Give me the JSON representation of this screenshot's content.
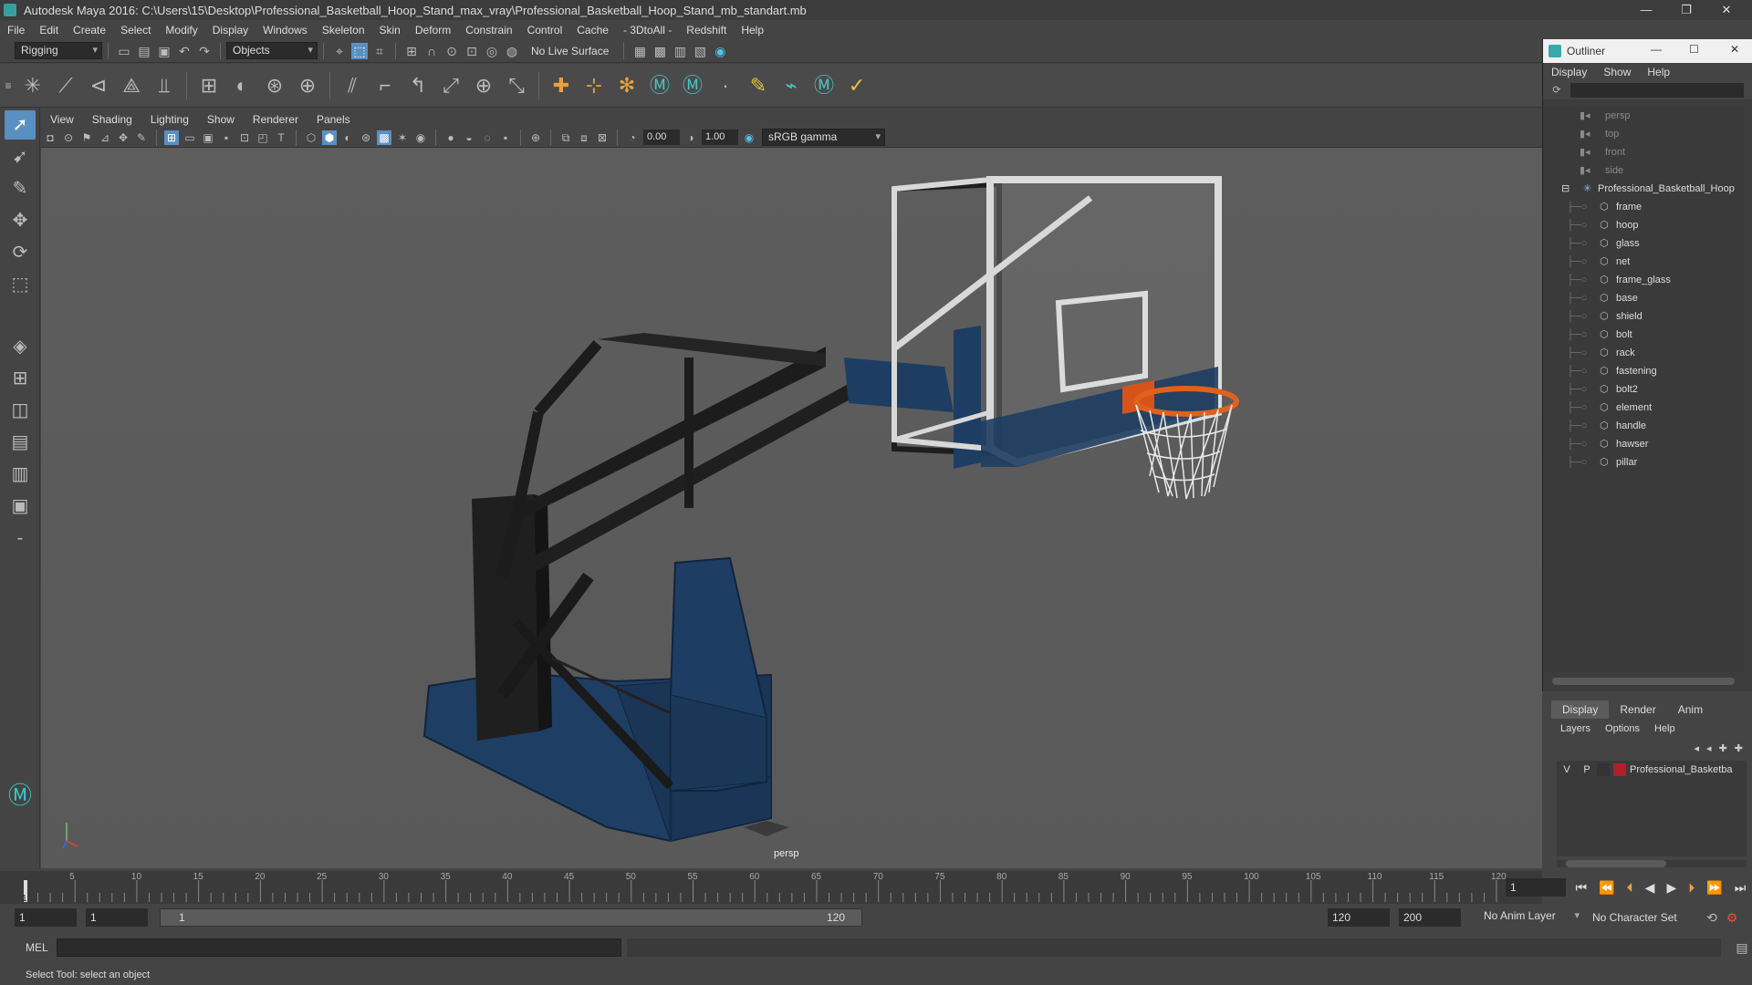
{
  "app": {
    "title": "Autodesk Maya 2016: C:\\Users\\15\\Desktop\\Professional_Basketball_Hoop_Stand_max_vray\\Professional_Basketball_Hoop_Stand_mb_standart.mb"
  },
  "menus": [
    "File",
    "Edit",
    "Create",
    "Select",
    "Modify",
    "Display",
    "Windows",
    "Skeleton",
    "Skin",
    "Deform",
    "Constrain",
    "Control",
    "Cache",
    "- 3DtoAll -",
    "Redshift",
    "Help"
  ],
  "status": {
    "mode": "Rigging",
    "selection": "Objects",
    "live_surface": "No Live Surface"
  },
  "viewport": {
    "menus": [
      "View",
      "Shading",
      "Lighting",
      "Show",
      "Renderer",
      "Panels"
    ],
    "exposure": "0.00",
    "gamma": "1.00",
    "color_space": "sRGB gamma",
    "camera": "persp"
  },
  "outliner": {
    "title": "Outliner",
    "menus": [
      "Display",
      "Show",
      "Help"
    ],
    "cameras": [
      "persp",
      "top",
      "front",
      "side"
    ],
    "root": "Professional_Basketball_Hoop",
    "children": [
      "frame",
      "hoop",
      "glass",
      "net",
      "frame_glass",
      "base",
      "shield",
      "bolt",
      "rack",
      "fastening",
      "bolt2",
      "element",
      "handle",
      "hawser",
      "pillar"
    ]
  },
  "layers": {
    "tabs": [
      "Display",
      "Render",
      "Anim"
    ],
    "menus": [
      "Layers",
      "Options",
      "Help"
    ],
    "v": "V",
    "p": "P",
    "name": "Professional_Basketba",
    "color": "#b0202a"
  },
  "timeline": {
    "ticks": [
      "5",
      "10",
      "15",
      "20",
      "25",
      "30",
      "35",
      "40",
      "45",
      "50",
      "55",
      "60",
      "65",
      "70",
      "75",
      "80",
      "85",
      "90",
      "95",
      "100",
      "105",
      "110",
      "115",
      "120"
    ],
    "current": "1",
    "start_label": "1"
  },
  "range": {
    "start": "1",
    "playback_start": "1",
    "range_start": "1",
    "range_end": "120",
    "end": "120",
    "max": "200",
    "anim_layer": "No Anim Layer",
    "char_set": "No Character Set"
  },
  "cmd": {
    "lang": "MEL"
  },
  "help": {
    "text": "Select Tool: select an object"
  }
}
